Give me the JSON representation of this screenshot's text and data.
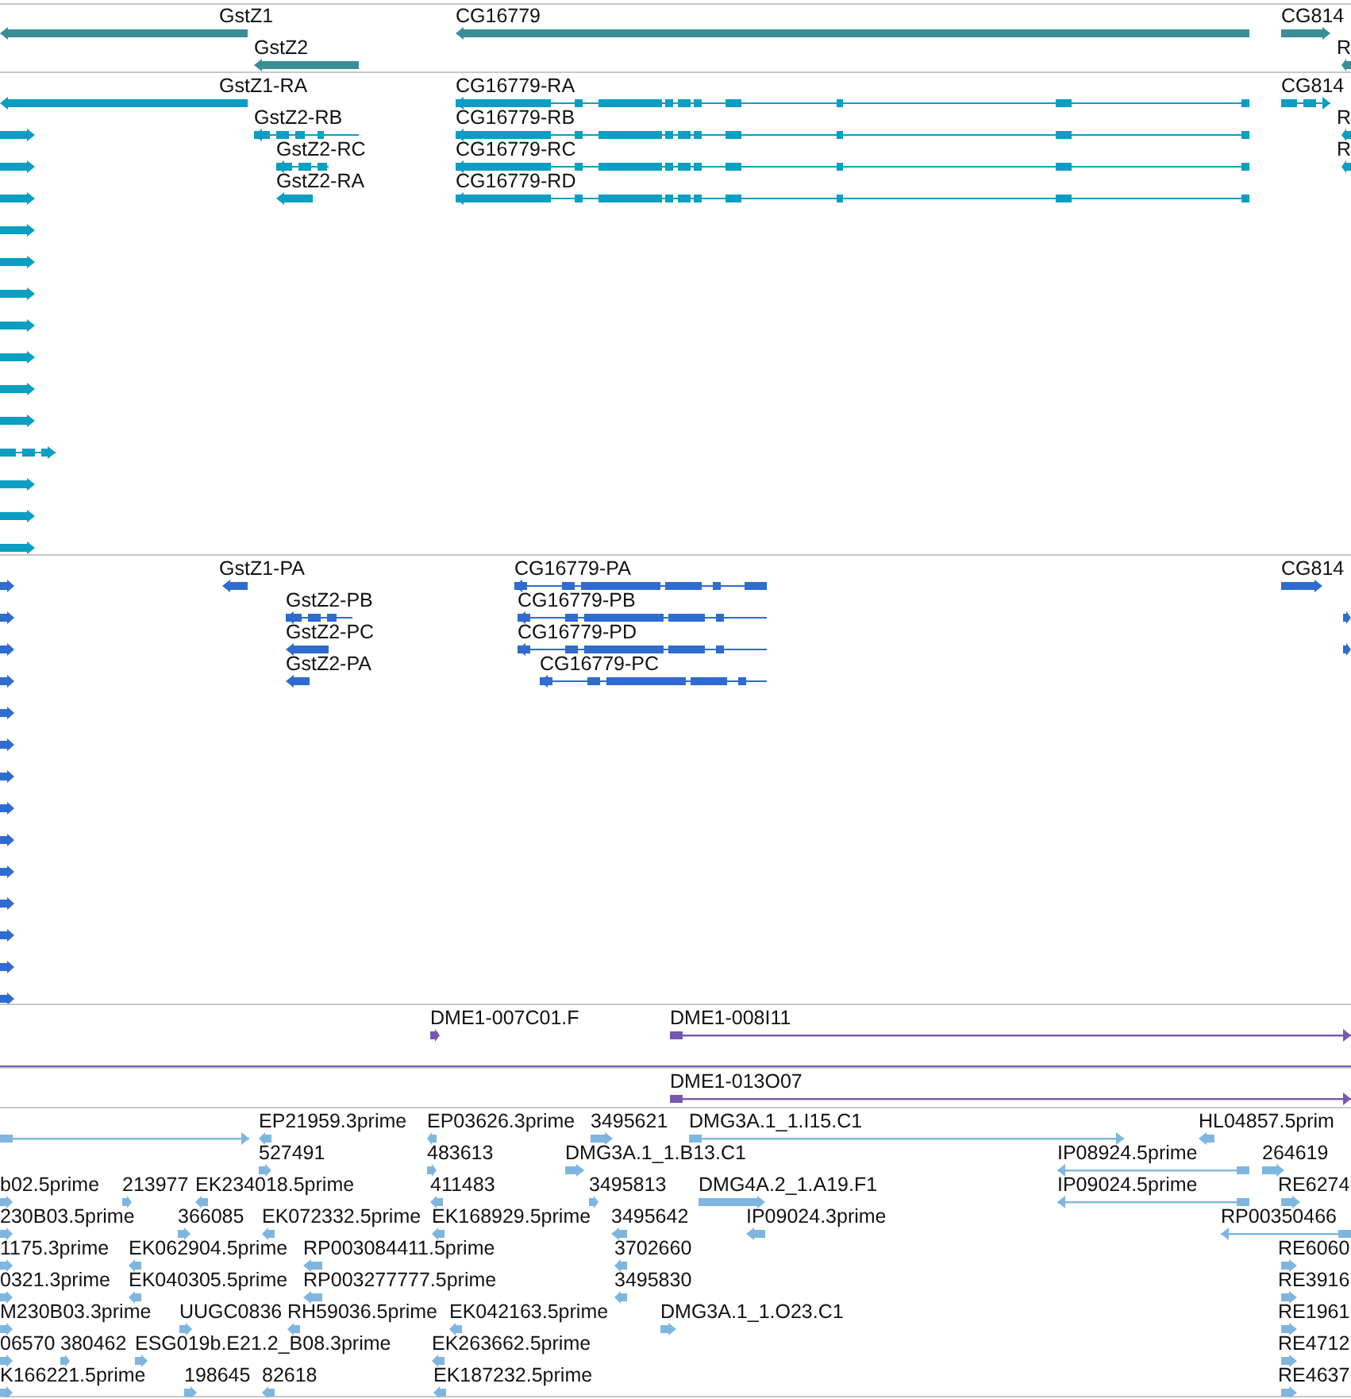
{
  "tracks": [
    {
      "kind": "gene",
      "features": [
        {
          "label": "GstZ1",
          "kind": "reverse"
        },
        {
          "label": "GstZ2",
          "kind": "reverse"
        },
        {
          "label": "CG16779",
          "kind": "reverse"
        },
        {
          "label": "CG814",
          "kind": "forward"
        },
        {
          "label": "R",
          "kind": "reverse"
        }
      ]
    },
    {
      "kind": "transcript",
      "features": [
        {
          "label": "GstZ1-RA",
          "kind": "reverse"
        },
        {
          "label": "GstZ2-RB",
          "kind": "reverse"
        },
        {
          "label": "GstZ2-RC",
          "kind": "reverse"
        },
        {
          "label": "GstZ2-RA",
          "kind": "reverse"
        },
        {
          "label": "CG16779-RA",
          "kind": "reverse"
        },
        {
          "label": "CG16779-RB",
          "kind": "reverse"
        },
        {
          "label": "CG16779-RC",
          "kind": "reverse"
        },
        {
          "label": "CG16779-RD",
          "kind": "reverse"
        },
        {
          "label": "CG814",
          "kind": "forward"
        },
        {
          "label": "R",
          "kind": "reverse"
        },
        {
          "label": "R",
          "kind": "reverse"
        }
      ]
    },
    {
      "kind": "protein",
      "features": [
        {
          "label": "GstZ1-PA",
          "kind": "reverse"
        },
        {
          "label": "GstZ2-PB",
          "kind": "reverse"
        },
        {
          "label": "GstZ2-PC",
          "kind": "reverse"
        },
        {
          "label": "GstZ2-PA",
          "kind": "reverse"
        },
        {
          "label": "CG16779-PA",
          "kind": "reverse"
        },
        {
          "label": "CG16779-PB",
          "kind": "reverse"
        },
        {
          "label": "CG16779-PD",
          "kind": "reverse"
        },
        {
          "label": "CG16779-PC",
          "kind": "reverse"
        },
        {
          "label": "CG814",
          "kind": "forward"
        }
      ]
    },
    {
      "kind": "clone",
      "features": [
        {
          "label": "DME1-007C01.F",
          "kind": "forward"
        },
        {
          "label": "DME1-008I11",
          "kind": "forward"
        }
      ]
    },
    {
      "kind": "clone",
      "features": [
        {
          "label": "DME1-013O07",
          "kind": "forward"
        }
      ]
    },
    {
      "kind": "est",
      "features": [
        {
          "label": "EP21959.3prime",
          "kind": "reverse"
        },
        {
          "label": "EP03626.3prime",
          "kind": "reverse"
        },
        {
          "label": "3495621",
          "kind": "forward"
        },
        {
          "label": "DMG3A.1_1.I15.C1",
          "kind": "forward"
        },
        {
          "label": "HL04857.5prim",
          "kind": "reverse"
        },
        {
          "label": "527491",
          "kind": "forward"
        },
        {
          "label": "483613",
          "kind": "forward"
        },
        {
          "label": "DMG3A.1_1.B13.C1",
          "kind": "forward"
        },
        {
          "label": "IP08924.5prime",
          "kind": "reverse"
        },
        {
          "label": "264619",
          "kind": "forward"
        },
        {
          "label": "b02.5prime",
          "kind": "forward"
        },
        {
          "label": "213977",
          "kind": "forward"
        },
        {
          "label": "EK234018.5prime",
          "kind": "reverse"
        },
        {
          "label": "411483",
          "kind": "reverse"
        },
        {
          "label": "3495813",
          "kind": "forward"
        },
        {
          "label": "DMG4A.2_1.A19.F1",
          "kind": "forward"
        },
        {
          "label": "IP09024.5prime",
          "kind": "reverse"
        },
        {
          "label": "RE6274",
          "kind": "forward"
        },
        {
          "label": "230B03.5prime",
          "kind": "forward"
        },
        {
          "label": "366085",
          "kind": "forward"
        },
        {
          "label": "EK072332.5prime",
          "kind": "reverse"
        },
        {
          "label": "EK168929.5prime",
          "kind": "reverse"
        },
        {
          "label": "3495642",
          "kind": "reverse"
        },
        {
          "label": "IP09024.3prime",
          "kind": "reverse"
        },
        {
          "label": "RP00350466",
          "kind": "reverse"
        },
        {
          "label": "1175.3prime",
          "kind": "forward"
        },
        {
          "label": "EK062904.5prime",
          "kind": "reverse"
        },
        {
          "label": "RP003084411.5prime",
          "kind": "reverse"
        },
        {
          "label": "3702660",
          "kind": "reverse"
        },
        {
          "label": "RE6060",
          "kind": "forward"
        },
        {
          "label": "0321.3prime",
          "kind": "forward"
        },
        {
          "label": "EK040305.5prime",
          "kind": "reverse"
        },
        {
          "label": "RP003277777.5prime",
          "kind": "reverse"
        },
        {
          "label": "3495830",
          "kind": "reverse"
        },
        {
          "label": "RE3916",
          "kind": "forward"
        },
        {
          "label": "M230B03.3prime",
          "kind": "forward"
        },
        {
          "label": "UUGC0836",
          "kind": "forward"
        },
        {
          "label": "RH59036.5prime",
          "kind": "reverse"
        },
        {
          "label": "EK042163.5prime",
          "kind": "reverse"
        },
        {
          "label": "DMG3A.1_1.O23.C1",
          "kind": "forward"
        },
        {
          "label": "RE1961",
          "kind": "forward"
        },
        {
          "label": "06570",
          "kind": "forward"
        },
        {
          "label": "380462",
          "kind": "forward"
        },
        {
          "label": "ESG019b.E21.2_B08.3prime",
          "kind": "forward"
        },
        {
          "label": "EK263662.5prime",
          "kind": "reverse"
        },
        {
          "label": "RE4712",
          "kind": "forward"
        },
        {
          "label": "K166221.5prime",
          "kind": "forward"
        },
        {
          "label": "198645",
          "kind": "forward"
        },
        {
          "label": "82618",
          "kind": "reverse"
        },
        {
          "label": "EK187232.5prime",
          "kind": "reverse"
        },
        {
          "label": "RE4637",
          "kind": "forward"
        }
      ]
    }
  ]
}
